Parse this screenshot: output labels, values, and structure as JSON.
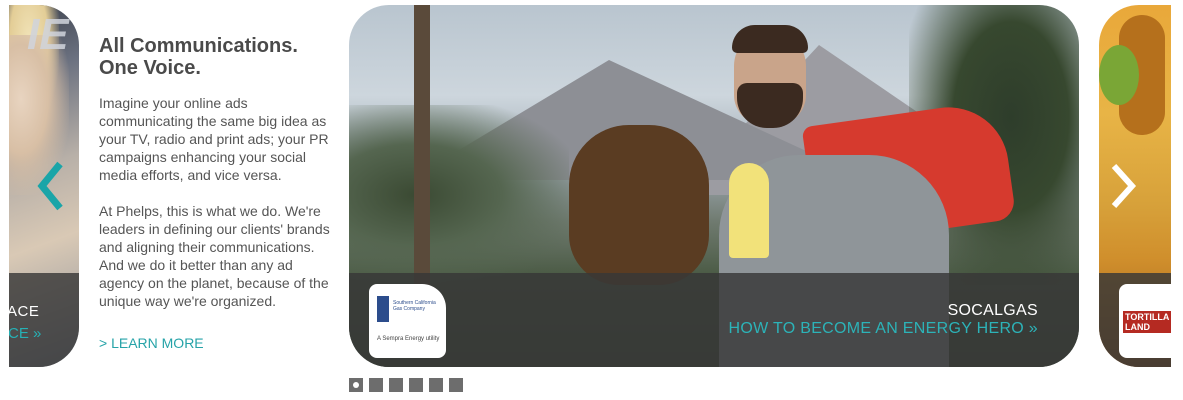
{
  "left_slide": {
    "client": "ACE",
    "cta": "CE »",
    "big_letters": "IE"
  },
  "intro": {
    "title_line1": "All Communications.",
    "title_line2": "One Voice.",
    "paragraph1": "Imagine your online ads communicating the same big idea as your TV, radio and print ads; your PR campaigns enhancing your social media efforts, and vice versa.",
    "paragraph2": "At Phelps, this is what we do. We're leaders in defining our clients' brands and aligning their communications. And we do it better than any ad agency on the planet, because of the unique way we're organized.",
    "learn_more": "> LEARN MORE"
  },
  "main_slide": {
    "client": "SOCALGAS",
    "headline": "HOW TO BECOME AN ENERGY HERO »",
    "logo_text": "Southern California Gas Company",
    "logo_sub": "A Sempra Energy utility"
  },
  "right_slide": {
    "logo_word": "TORTILLA LAND"
  },
  "pagination": {
    "count": 6,
    "active_index": 0
  },
  "colors": {
    "accent": "#26a3a8",
    "band": "#373737",
    "dot": "#6d6d6d"
  },
  "icons": {
    "prev": "chevron-left-icon",
    "next": "chevron-right-icon"
  }
}
